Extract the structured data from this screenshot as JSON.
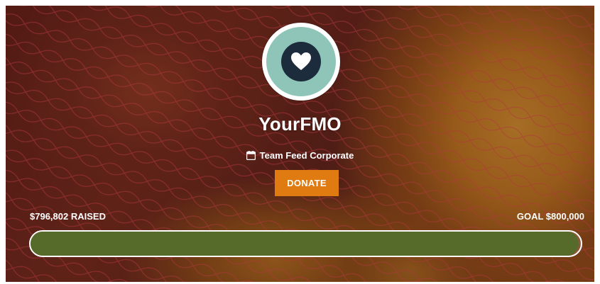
{
  "organization": {
    "name": "YourFMO",
    "logo_icon": "heart-icon"
  },
  "team": {
    "icon": "calendar-icon",
    "label": "Team Feed Corporate"
  },
  "donate_button": {
    "label": "DONATE"
  },
  "campaign": {
    "raised_label": "$796,802 RAISED",
    "goal_label": "GOAL $800,000",
    "progress_fraction": 0.996
  },
  "colors": {
    "accent": "#e07b12",
    "progress": "#566a2a",
    "logo_ring": "#8fc5b8",
    "logo_core": "#1d2c3c"
  }
}
